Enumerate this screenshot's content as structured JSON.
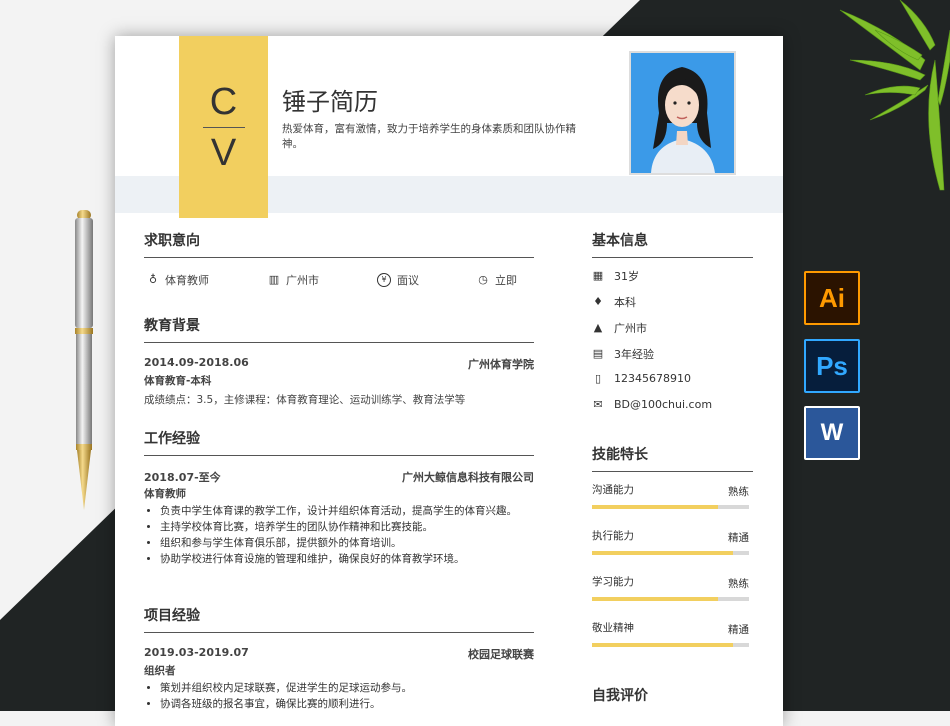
{
  "header": {
    "cv_top": "C",
    "cv_bottom": "V",
    "name": "锤子简历",
    "intro": "热爱体育，富有激情，致力于培养学生的身体素质和团队协作精神。"
  },
  "intent": {
    "title": "求职意向",
    "items": [
      {
        "icon": "tie-icon",
        "text": "体育教师"
      },
      {
        "icon": "building-icon",
        "text": "广州市"
      },
      {
        "icon": "yen-icon",
        "text": "面议"
      },
      {
        "icon": "clock-icon",
        "text": "立即"
      }
    ]
  },
  "education": {
    "title": "教育背景",
    "period": "2014.09-2018.06",
    "school": "广州体育学院",
    "degree": "体育教育-本科",
    "detail": "成绩绩点：3.5，主修课程：体育教育理论、运动训练学、教育法学等"
  },
  "work": {
    "title": "工作经验",
    "period": "2018.07-至今",
    "company": "广州大鲸信息科技有限公司",
    "role": "体育教师",
    "bullets": [
      "负责中学生体育课的教学工作，设计并组织体育活动，提高学生的体育兴趣。",
      "主持学校体育比赛，培养学生的团队协作精神和比赛技能。",
      "组织和参与学生体育俱乐部，提供额外的体育培训。",
      "协助学校进行体育设施的管理和维护，确保良好的体育教学环境。"
    ]
  },
  "project": {
    "title": "项目经验",
    "period": "2019.03-2019.07",
    "name": "校园足球联赛",
    "role": "组织者",
    "bullets": [
      "策划并组织校内足球联赛，促进学生的足球运动参与。",
      "协调各班级的报名事宜，确保比赛的顺利进行。"
    ]
  },
  "basic": {
    "title": "基本信息",
    "items": [
      {
        "icon": "calendar-icon",
        "text": "31岁"
      },
      {
        "icon": "graduation-cap-icon",
        "text": "本科"
      },
      {
        "icon": "bank-icon",
        "text": "广州市"
      },
      {
        "icon": "document-icon",
        "text": "3年经验"
      },
      {
        "icon": "phone-icon",
        "text": "12345678910"
      },
      {
        "icon": "mail-icon",
        "text": "BD@100chui.com"
      }
    ]
  },
  "skills": {
    "title": "技能特长",
    "items": [
      {
        "name": "沟通能力",
        "level": "熟练",
        "fill": 0.8
      },
      {
        "name": "执行能力",
        "level": "精通",
        "fill": 0.9
      },
      {
        "name": "学习能力",
        "level": "熟练",
        "fill": 0.8
      },
      {
        "name": "敬业精神",
        "level": "精通",
        "fill": 0.9
      }
    ]
  },
  "self_eval": {
    "title": "自我评价"
  },
  "app_icons": {
    "ai": {
      "label": "Ai",
      "bg": "#2b1300",
      "fg": "#ff9a00"
    },
    "ps": {
      "label": "Ps",
      "bg": "#061e3c",
      "fg": "#31a8ff"
    },
    "word": {
      "label": "W",
      "bg": "#2b579a",
      "fg": "#ffffff"
    }
  },
  "colors": {
    "accent": "#f2cf5f",
    "dark_bg": "#202424"
  }
}
